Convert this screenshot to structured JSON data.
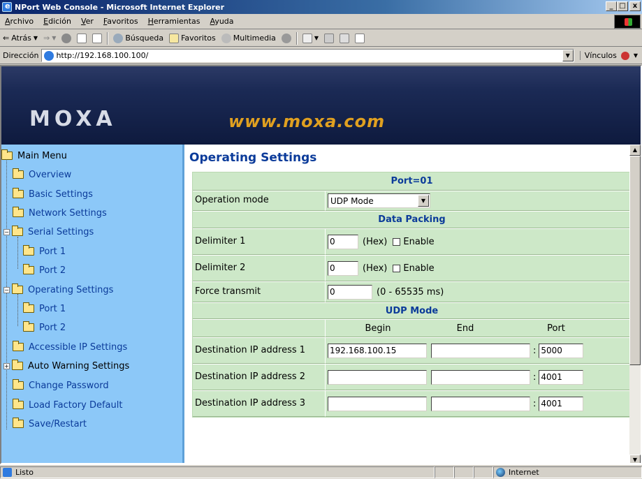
{
  "window": {
    "title": "NPort Web Console - Microsoft Internet Explorer",
    "min": "_",
    "max": "□",
    "close": "x"
  },
  "menu": [
    "Archivo",
    "Edición",
    "Ver",
    "Favoritos",
    "Herramientas",
    "Ayuda"
  ],
  "toolbar": {
    "back": "Atrás",
    "search": "Búsqueda",
    "favorites": "Favoritos",
    "multimedia": "Multimedia"
  },
  "address": {
    "label": "Dirección",
    "url": "http://192.168.100.100/",
    "links": "Vínculos"
  },
  "banner": {
    "logo": "MOXA",
    "site": "www.moxa.com"
  },
  "sidebar": {
    "root": "Main Menu",
    "items": {
      "overview": "Overview",
      "basic": "Basic Settings",
      "network": "Network Settings",
      "serial": "Serial Settings",
      "serial_port1": "Port 1",
      "serial_port2": "Port 2",
      "operating": "Operating Settings",
      "op_port1": "Port 1",
      "op_port2": "Port 2",
      "accessible": "Accessible IP Settings",
      "auto_warning": "Auto Warning Settings",
      "change_pw": "Change Password",
      "load_factory": "Load Factory Default",
      "save_restart": "Save/Restart"
    }
  },
  "content": {
    "title": "Operating Settings",
    "port_header": "Port=01",
    "operation_mode_label": "Operation mode",
    "operation_mode_value": "UDP Mode",
    "data_packing_header": "Data Packing",
    "delimiter1_label": "Delimiter 1",
    "delimiter1_value": "0",
    "delimiter2_label": "Delimiter 2",
    "delimiter2_value": "0",
    "hex_unit": "(Hex)",
    "enable_label": "Enable",
    "force_transmit_label": "Force transmit",
    "force_transmit_value": "0",
    "force_transmit_unit": "(0 - 65535 ms)",
    "udp_header": "UDP Mode",
    "col_begin": "Begin",
    "col_end": "End",
    "col_port": "Port",
    "dest": [
      {
        "label": "Destination IP address 1",
        "begin": "192.168.100.15",
        "end": "",
        "port": "5000"
      },
      {
        "label": "Destination IP address 2",
        "begin": "",
        "end": "",
        "port": "4001"
      },
      {
        "label": "Destination IP address 3",
        "begin": "",
        "end": "",
        "port": "4001"
      }
    ],
    "colon": ":"
  },
  "status": {
    "text": "Listo",
    "zone": "Internet"
  }
}
